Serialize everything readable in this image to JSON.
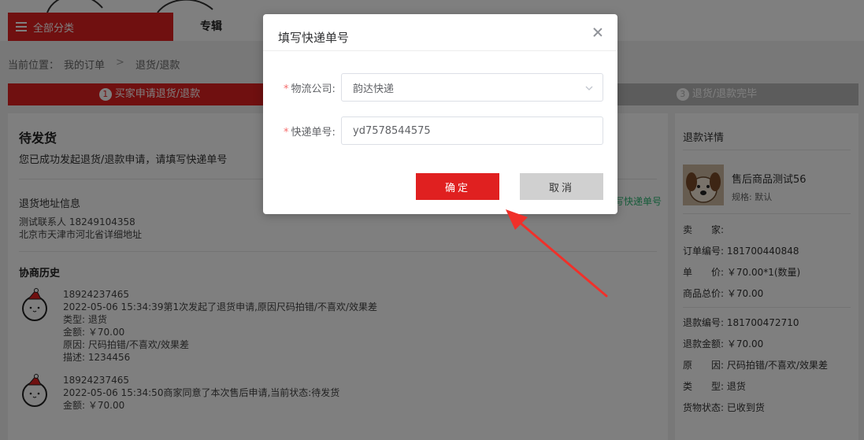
{
  "nav": {
    "all_categories": "全部分类",
    "album": "专辑"
  },
  "breadcrumb": {
    "prefix": "当前位置：",
    "orders": "我的订单",
    "current": "退货/退款"
  },
  "steps": [
    {
      "num": "1",
      "label": "买家申请退货/退款"
    },
    {
      "num": "2",
      "label": ""
    },
    {
      "num": "3",
      "label": "退货/退款完毕"
    }
  ],
  "status": {
    "title": "待发货",
    "desc": "您已成功发起退货/退款申请，请填写快递单号",
    "fill_link": "写快递单号"
  },
  "address": {
    "title": "退货地址信息",
    "contact": "测试联系人  18249104358",
    "line": "北京市天津市河北省详细地址"
  },
  "history": {
    "title": "协商历史",
    "items": [
      {
        "user": "18924237465",
        "event": "2022-05-06 15:34:39第1次发起了退货申请,原因尺码拍错/不喜欢/效果差",
        "type": "类型: 退货",
        "amount": "金额: ￥70.00",
        "reason": "原因: 尺码拍错/不喜欢/效果差",
        "note": "描述: 1234456"
      },
      {
        "user": "18924237465",
        "event": "2022-05-06 15:34:50商家同意了本次售后申请,当前状态:待发货",
        "amount": "金额: ￥70.00"
      }
    ]
  },
  "side": {
    "title": "退款详情",
    "product_name": "售后商品测试56",
    "product_spec": "规格: 默认",
    "seller": "卖　　家:",
    "order_no": "订单编号: 181700440848",
    "unit_price": "单　　价: ￥70.00*1(数量)",
    "total": "商品总价: ￥70.00",
    "refund_no": "退款编号: 181700472710",
    "refund_amount": "退款金额: ￥70.00",
    "reason": "原　　因: 尺码拍错/不喜欢/效果差",
    "type": "类　　型: 退货",
    "goods_status": "货物状态: 已收到货"
  },
  "modal": {
    "title": "填写快递单号",
    "company_label": "物流公司:",
    "company_value": "韵达快递",
    "tracking_label": "快递单号:",
    "tracking_value": "yd7578544575",
    "ok_label": "确定",
    "cancel_label": "取消"
  },
  "colors": {
    "accent": "#e02020",
    "link_green": "#2bb673",
    "required": "#f56c6c"
  }
}
